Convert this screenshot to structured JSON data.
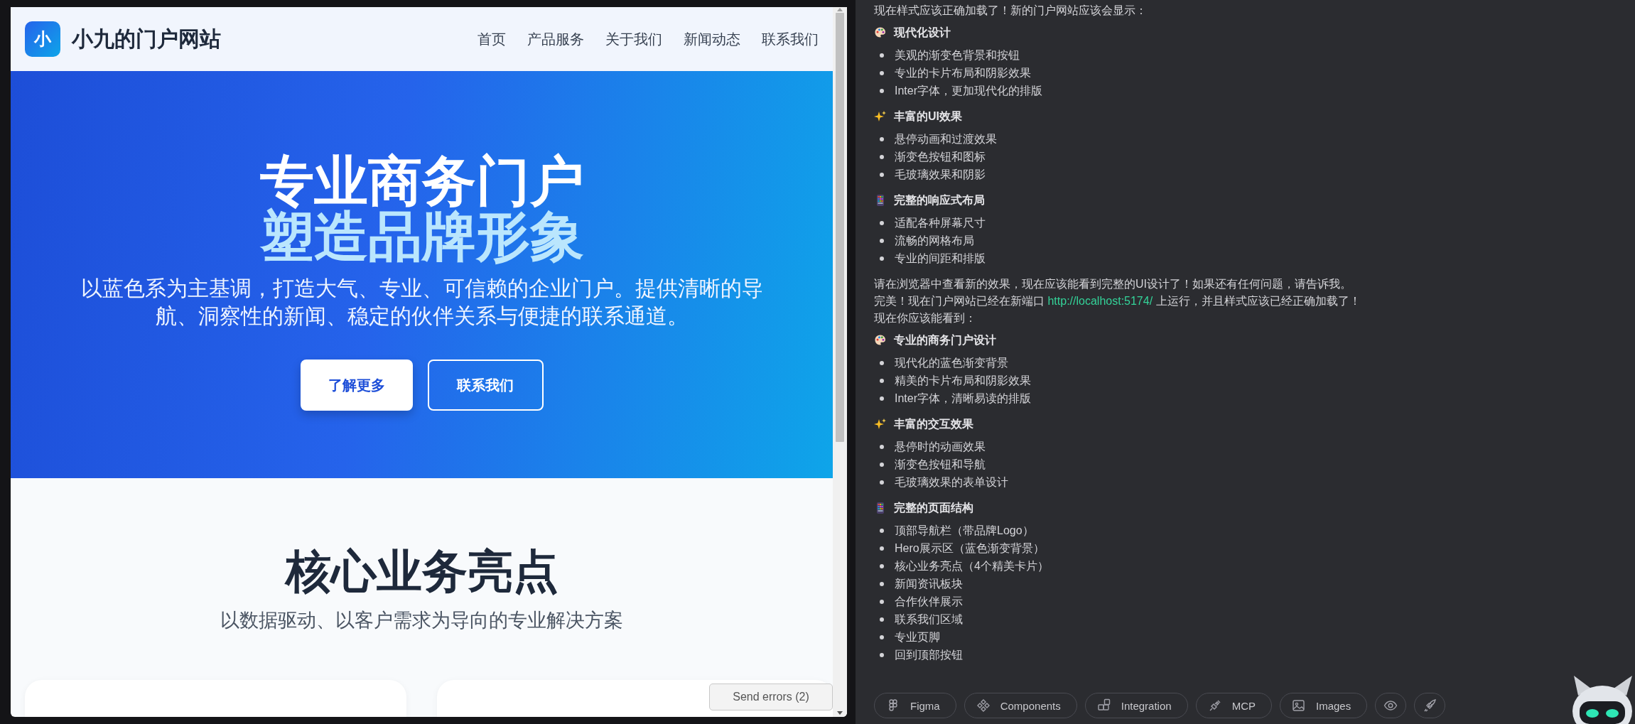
{
  "site": {
    "nav": {
      "logo_mark": "小",
      "title": "小九的门户网站",
      "links": [
        "首页",
        "产品服务",
        "关于我们",
        "新闻动态",
        "联系我们"
      ]
    },
    "hero": {
      "title_line1": "专业商务门户",
      "title_line2": "塑造品牌形象",
      "subtitle": "以蓝色系为主基调，打造大气、专业、可信赖的企业门户。提供清晰的导航、洞察性的新闻、稳定的伙伴关系与便捷的联系通道。",
      "buttons": [
        {
          "label": "了解更多",
          "kind": "primary"
        },
        {
          "label": "联系我们",
          "kind": "outline"
        }
      ]
    },
    "section": {
      "title": "核心业务亮点",
      "subtitle": "以数据驱动、以客户需求为导向的专业解决方案"
    },
    "send_errors": "Send errors (2)"
  },
  "chat": {
    "blocks": [
      {
        "kind": "text",
        "text": "现在样式应该正确加载了！新的门户网站应该会显示："
      },
      {
        "kind": "group",
        "title": "现代化设计",
        "items": [
          "美观的渐变色背景和按钮",
          "专业的卡片布局和阴影效果",
          "Inter字体，更加现代化的排版"
        ]
      },
      {
        "kind": "group",
        "title": "丰富的UI效果",
        "items": [
          "悬停动画和过渡效果",
          "渐变色按钮和图标",
          "毛玻璃效果和阴影"
        ]
      },
      {
        "kind": "group",
        "title": "完整的响应式布局",
        "items": [
          "适配各种屏幕尺寸",
          "流畅的网格布局",
          "专业的间距和排版"
        ]
      },
      {
        "kind": "text",
        "text": "请在浏览器中查看新的效果，现在应该能看到完整的UI设计了！如果还有任何问题，请告诉我。"
      },
      {
        "kind": "link_text",
        "before": "完美！现在门户网站已经在新端口 ",
        "link": "http://localhost:5174/",
        "after": " 上运行，并且样式应该已经正确加载了！"
      },
      {
        "kind": "text",
        "text": "现在你应该能看到："
      },
      {
        "kind": "group",
        "title": "专业的商务门户设计",
        "items": [
          "现代化的蓝色渐变背景",
          "精美的卡片布局和阴影效果",
          "Inter字体，清晰易读的排版"
        ]
      },
      {
        "kind": "group",
        "title": "丰富的交互效果",
        "items": [
          "悬停时的动画效果",
          "渐变色按钮和导航",
          "毛玻璃效果的表单设计"
        ]
      },
      {
        "kind": "group",
        "title": "完整的页面结构",
        "items": [
          "顶部导航栏（带品牌Logo）",
          "Hero展示区（蓝色渐变背景）",
          "核心业务亮点（4个精美卡片）",
          "新闻资讯板块",
          "合作伙伴展示",
          "联系我们区域",
          "专业页脚",
          "回到顶部按钮"
        ]
      }
    ],
    "toolbar": [
      {
        "kind": "labeled",
        "label": "Figma"
      },
      {
        "kind": "labeled",
        "label": "Components"
      },
      {
        "kind": "labeled",
        "label": "Integration"
      },
      {
        "kind": "labeled",
        "label": "MCP"
      },
      {
        "kind": "labeled",
        "label": "Images"
      },
      {
        "kind": "icon"
      },
      {
        "kind": "icon"
      }
    ]
  }
}
